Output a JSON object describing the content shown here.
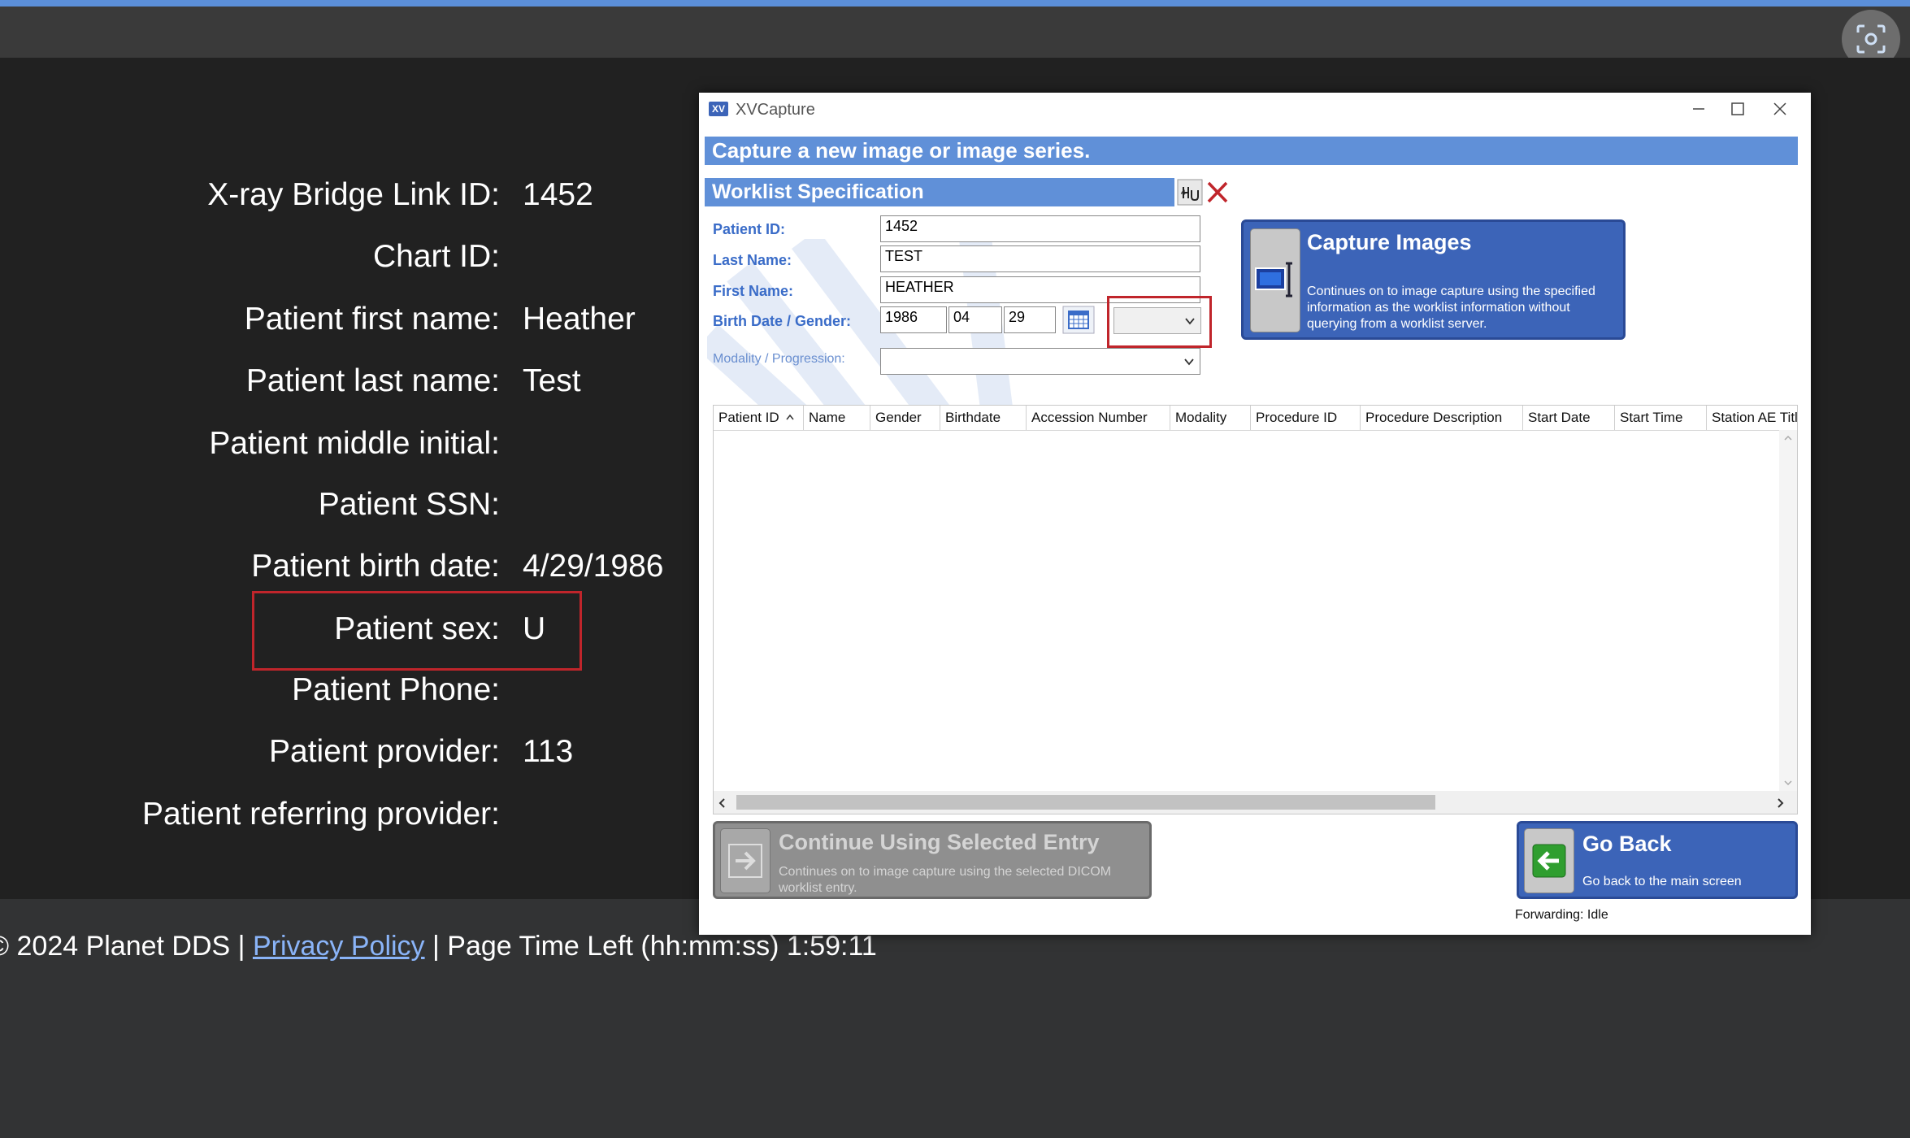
{
  "patient_info": [
    {
      "label": "X-ray Bridge Link ID:",
      "value": "1452"
    },
    {
      "label": "Chart ID:",
      "value": ""
    },
    {
      "label": "Patient first name:",
      "value": "Heather"
    },
    {
      "label": "Patient last name:",
      "value": "Test"
    },
    {
      "label": "Patient middle initial:",
      "value": ""
    },
    {
      "label": "Patient SSN:",
      "value": ""
    },
    {
      "label": "Patient birth date:",
      "value": "4/29/1986"
    },
    {
      "label": "Patient sex:",
      "value": "U"
    },
    {
      "label": "Patient Phone:",
      "value": ""
    },
    {
      "label": "Patient provider:",
      "value": "113"
    },
    {
      "label": "Patient referring provider:",
      "value": ""
    }
  ],
  "footer": {
    "copyright": "© 2024 Planet DDS |",
    "privacy_link": "Privacy Policy",
    "time_left": "|  Page Time Left (hh:mm:ss) 1:59:11"
  },
  "window": {
    "app_icon": "XV",
    "title": "XVCapture",
    "header": "Capture a new image or image series.",
    "worklist_title": "Worklist Specification",
    "fields": {
      "patient_id_label": "Patient ID:",
      "patient_id": "1452",
      "last_name_label": "Last Name:",
      "last_name": "TEST",
      "first_name_label": "First Name:",
      "first_name": "HEATHER",
      "birth_gender_label": "Birth Date / Gender:",
      "birth_year": "1986",
      "birth_month": "04",
      "birth_day": "29",
      "modality_label": "Modality / Progression:"
    },
    "capture_btn": {
      "title": "Capture Images",
      "desc": "Continues on to image capture using the specified information as the worklist information without querying from a worklist server."
    },
    "columns": [
      "Patient ID",
      "Name",
      "Gender",
      "Birthdate",
      "Accession Number",
      "Modality",
      "Procedure ID",
      "Procedure Description",
      "Start Date",
      "Start Time",
      "Station AE Titl"
    ],
    "continue_btn": {
      "title": "Continue Using Selected Entry",
      "desc": "Continues on to image capture using the selected DICOM worklist entry."
    },
    "goback_btn": {
      "title": "Go Back",
      "desc": "Go back to the main screen"
    },
    "status": "Forwarding: Idle"
  },
  "colors": {
    "accent": "#5b8fd9",
    "highlight": "#c0252b",
    "button_blue": "#3c64b8"
  }
}
